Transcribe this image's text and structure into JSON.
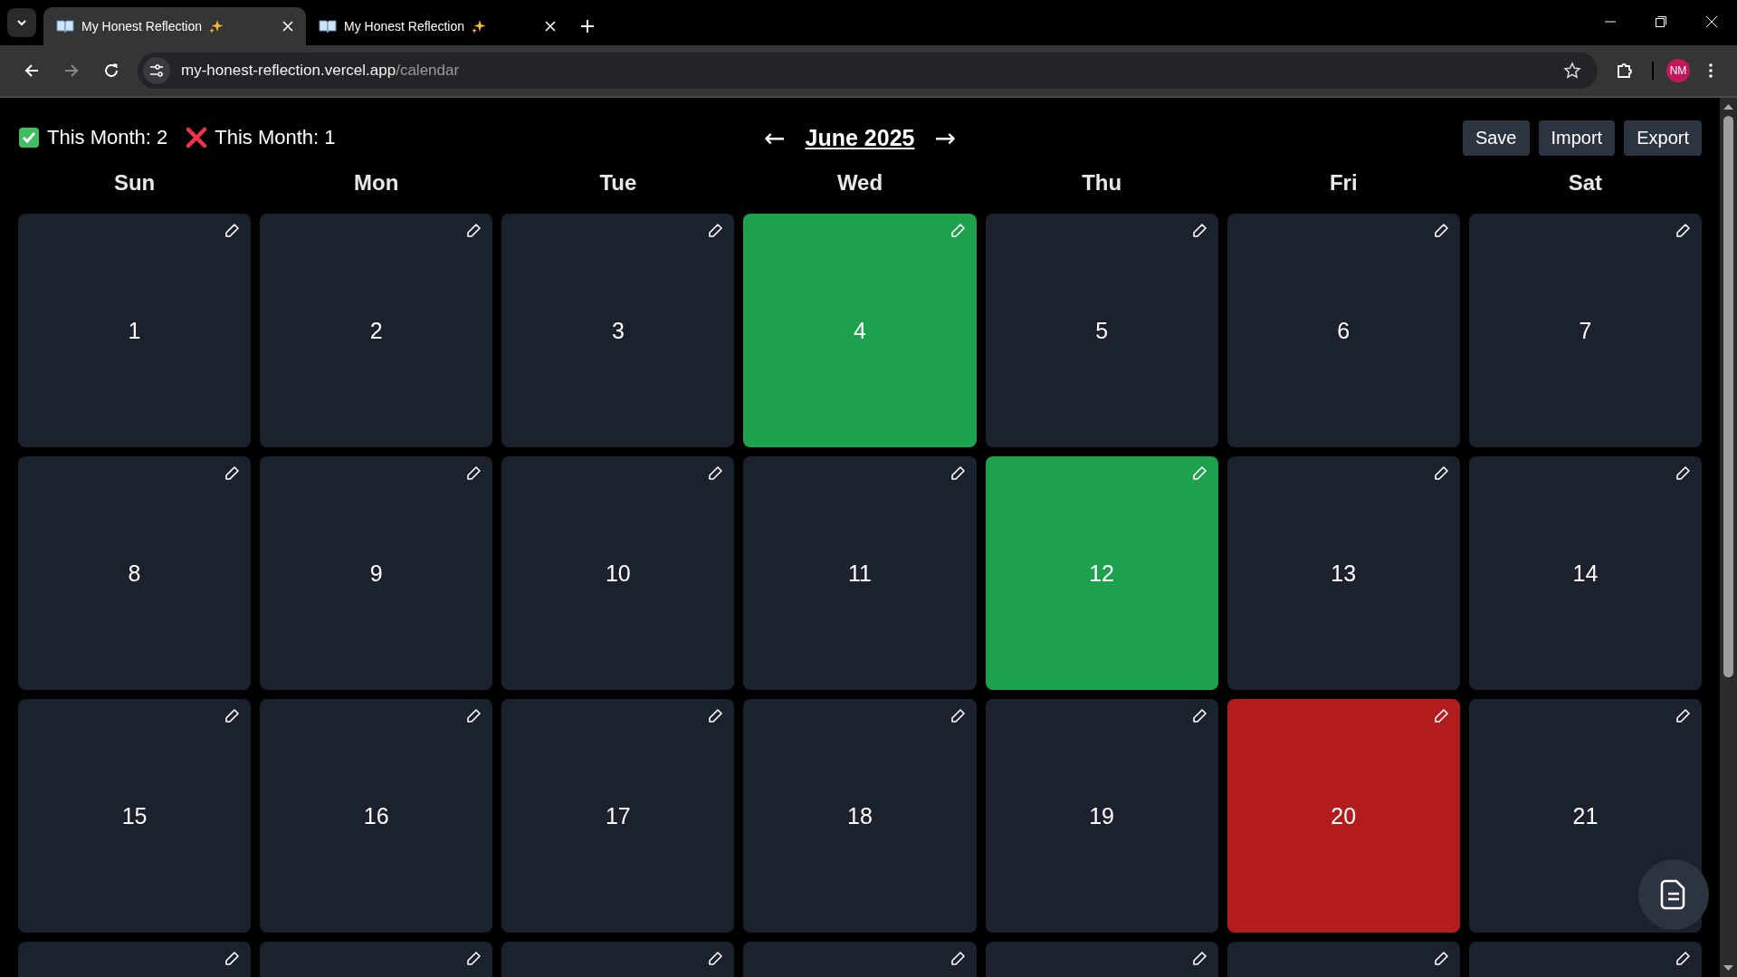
{
  "browser": {
    "tabs": [
      {
        "title": "My Honest Reflection",
        "selected": true
      },
      {
        "title": "My Honest Reflection",
        "selected": false
      }
    ],
    "url_host": "my-honest-reflection.vercel.app",
    "url_path": "/calendar",
    "profile_initials": "NM"
  },
  "summary": [
    {
      "kind": "success",
      "label": "This Month: 2"
    },
    {
      "kind": "fail",
      "label": "This Month: 1"
    }
  ],
  "month": {
    "prev": "←",
    "title": "June 2025",
    "next": "→"
  },
  "buttons": [
    "Save",
    "Import",
    "Export"
  ],
  "weekdays": [
    "Sun",
    "Mon",
    "Tue",
    "Wed",
    "Thu",
    "Fri",
    "Sat"
  ],
  "weeks": [
    [
      {
        "day": "1",
        "kind": "none"
      },
      {
        "day": "2",
        "kind": "none"
      },
      {
        "day": "3",
        "kind": "none"
      },
      {
        "day": "4",
        "kind": "success"
      },
      {
        "day": "5",
        "kind": "none"
      },
      {
        "day": "6",
        "kind": "none"
      },
      {
        "day": "7",
        "kind": "none"
      }
    ],
    [
      {
        "day": "8",
        "kind": "none"
      },
      {
        "day": "9",
        "kind": "none"
      },
      {
        "day": "10",
        "kind": "none"
      },
      {
        "day": "11",
        "kind": "none"
      },
      {
        "day": "12",
        "kind": "success"
      },
      {
        "day": "13",
        "kind": "none"
      },
      {
        "day": "14",
        "kind": "none"
      }
    ],
    [
      {
        "day": "15",
        "kind": "none"
      },
      {
        "day": "16",
        "kind": "none"
      },
      {
        "day": "17",
        "kind": "none"
      },
      {
        "day": "18",
        "kind": "none"
      },
      {
        "day": "19",
        "kind": "none"
      },
      {
        "day": "20",
        "kind": "fail"
      },
      {
        "day": "21",
        "kind": "none"
      }
    ],
    [
      {
        "kind": "none"
      },
      {
        "kind": "none"
      },
      {
        "kind": "none"
      },
      {
        "kind": "none"
      },
      {
        "kind": "none"
      },
      {
        "kind": "none"
      },
      {
        "kind": "none"
      }
    ]
  ]
}
